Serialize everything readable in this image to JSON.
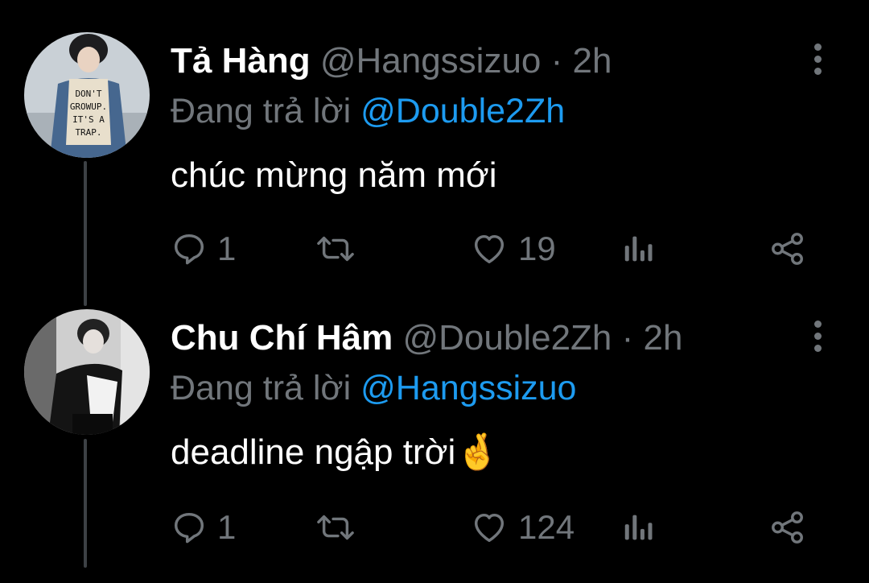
{
  "colors": {
    "background": "#000000",
    "name": "#ffffff",
    "secondary": "#71767b",
    "mention": "#1d9bf0",
    "thread_line": "#3d4145"
  },
  "tweets": [
    {
      "name": "Tả Hàng",
      "handle": "@Hangssizuo",
      "separator": "·",
      "time": "2h",
      "reply_prefix": "Đang trả lời",
      "reply_to": "@Double2Zh",
      "text": "chúc mừng năm mới",
      "emoji": "",
      "reply_count": "1",
      "retweet_count": "",
      "like_count": "19",
      "avatar_text": "DON'T GROW UP. IT'S A TRAP.",
      "icons": [
        "reply-icon",
        "retweet-icon",
        "like-icon",
        "analytics-icon",
        "share-icon",
        "more-icon"
      ]
    },
    {
      "name": "Chu Chí Hâm",
      "handle": "@Double2Zh",
      "separator": "·",
      "time": "2h",
      "reply_prefix": "Đang trả lời",
      "reply_to": "@Hangssizuo",
      "text": "deadline ngập trời",
      "emoji": "🤞",
      "reply_count": "1",
      "retweet_count": "",
      "like_count": "124",
      "icons": [
        "reply-icon",
        "retweet-icon",
        "like-icon",
        "analytics-icon",
        "share-icon",
        "more-icon"
      ]
    }
  ]
}
